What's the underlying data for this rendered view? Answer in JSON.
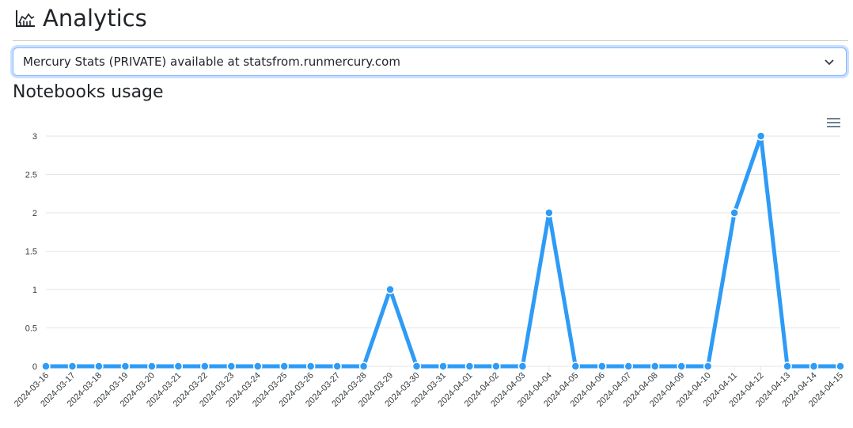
{
  "header": {
    "title": "Analytics",
    "icon": "chart-area-icon"
  },
  "selector": {
    "value": "Mercury Stats (PRIVATE) available at statsfrom.runmercury.com",
    "icon": "chevron-down-icon"
  },
  "section": {
    "title": "Notebooks usage",
    "menu_icon": "hamburger-menu-icon"
  },
  "colors": {
    "series": "#2e9bf6",
    "grid": "#e6e6e6",
    "text": "#212529"
  },
  "chart_data": {
    "type": "line",
    "title": "Notebooks usage",
    "xlabel": "",
    "ylabel": "",
    "ylim": [
      0,
      3
    ],
    "yticks": [
      "0",
      "0.5",
      "1",
      "1.5",
      "2",
      "2.5",
      "3"
    ],
    "grid": true,
    "legend": "none",
    "categories": [
      "2024-03-16",
      "2024-03-17",
      "2024-03-18",
      "2024-03-19",
      "2024-03-20",
      "2024-03-21",
      "2024-03-22",
      "2024-03-23",
      "2024-03-24",
      "2024-03-25",
      "2024-03-26",
      "2024-03-27",
      "2024-03-28",
      "2024-03-29",
      "2024-03-30",
      "2024-03-31",
      "2024-04-01",
      "2024-04-02",
      "2024-04-03",
      "2024-04-04",
      "2024-04-05",
      "2024-04-06",
      "2024-04-07",
      "2024-04-08",
      "2024-04-09",
      "2024-04-10",
      "2024-04-11",
      "2024-04-12",
      "2024-04-13",
      "2024-04-14",
      "2024-04-15"
    ],
    "series": [
      {
        "name": "Notebooks usage",
        "values": [
          0,
          0,
          0,
          0,
          0,
          0,
          0,
          0,
          0,
          0,
          0,
          0,
          0,
          1,
          0,
          0,
          0,
          0,
          0,
          2,
          0,
          0,
          0,
          0,
          0,
          0,
          2,
          3,
          0,
          0,
          0
        ]
      }
    ]
  }
}
